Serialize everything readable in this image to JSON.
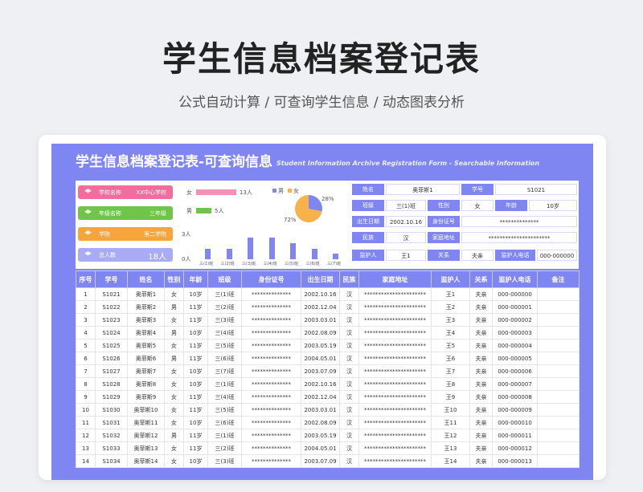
{
  "hero": {
    "title": "学生信息档案登记表",
    "subtitle": "公式自动计算 /  可查询学生信息  / 动态图表分析"
  },
  "sheet": {
    "title": "学生信息档案登记表-可查询信息",
    "title_en": "Student Information Archive Registration Form - Searchable Information"
  },
  "summary": [
    {
      "label": "学校名称",
      "value": "XX中心学校",
      "color": "#f26d9b"
    },
    {
      "label": "年级名称",
      "value": "三年级",
      "color": "#6ec54a"
    },
    {
      "label": "学院",
      "value": "第二学院",
      "color": "#f7a43a"
    },
    {
      "label": "总人数",
      "value": "18人",
      "color": "#a9acf5"
    }
  ],
  "gender_bars": [
    {
      "label": "女",
      "value": 13,
      "display": "13人",
      "color": "#f590b6"
    },
    {
      "label": "男",
      "value": 5,
      "display": "5人",
      "color": "#6ec54a"
    }
  ],
  "pie": {
    "legend": [
      "男",
      "女"
    ],
    "male_pct": 28,
    "female_pct": 72,
    "male_label": "28%",
    "female_label": "72%",
    "male_color": "#7f86f2",
    "female_color": "#f7b24a"
  },
  "class_chart": {
    "ytop": "3人",
    "ybottom": "0人",
    "categories": [
      "三(1)班",
      "三(2)班",
      "三(3)班",
      "三(4)班",
      "三(5)班",
      "三(6)班",
      "三(7)班"
    ],
    "values": [
      2,
      2,
      4,
      4,
      3,
      2,
      1
    ],
    "ymax": 4.5
  },
  "info": {
    "name_label": "姓名",
    "name": "奥菲斯1",
    "id_label": "学号",
    "id": "S1021",
    "class_label": "班级",
    "class": "三(1)班",
    "gender_label": "性别",
    "gender": "女",
    "age_label": "年龄",
    "age": "10岁",
    "birth_label": "出生日期",
    "birth": "2002.10.16",
    "idcard_label": "身份证号",
    "idcard": "**************",
    "ethnic_label": "民族",
    "ethnic": "汉",
    "address_label": "家庭地址",
    "address": "**********************",
    "guardian_label": "监护人",
    "guardian": "王1",
    "relation_label": "关系",
    "relation": "夫亲",
    "phone_label": "监护人电话",
    "phone": "000-000000"
  },
  "table": {
    "headers": [
      "序号",
      "学号",
      "姓名",
      "性别",
      "年龄",
      "班级",
      "身份证号",
      "出生日期",
      "民族",
      "家庭地址",
      "监护人",
      "关系",
      "监护人电话",
      "备注"
    ],
    "rows": [
      [
        "1",
        "S1021",
        "奥菲斯1",
        "女",
        "10岁",
        "三(1)班",
        "**************",
        "2002.10.16",
        "汉",
        "**********************",
        "王1",
        "夫亲",
        "000-000000",
        ""
      ],
      [
        "2",
        "S1022",
        "奥菲斯2",
        "男",
        "11岁",
        "三(2)班",
        "**************",
        "2002.12.04",
        "汉",
        "**********************",
        "王2",
        "夫亲",
        "000-000001",
        ""
      ],
      [
        "3",
        "S1023",
        "奥菲斯3",
        "女",
        "11岁",
        "三(3)班",
        "**************",
        "2003.03.01",
        "汉",
        "**********************",
        "王3",
        "夫亲",
        "000-000002",
        ""
      ],
      [
        "4",
        "S1024",
        "奥菲斯4",
        "男",
        "10岁",
        "三(4)班",
        "**************",
        "2002.08.09",
        "汉",
        "**********************",
        "王4",
        "夫亲",
        "000-000003",
        ""
      ],
      [
        "5",
        "S1025",
        "奥菲斯5",
        "女",
        "11岁",
        "三(5)班",
        "**************",
        "2003.05.19",
        "汉",
        "**********************",
        "王5",
        "夫亲",
        "000-000004",
        ""
      ],
      [
        "6",
        "S1026",
        "奥菲斯6",
        "男",
        "11岁",
        "三(6)班",
        "**************",
        "2004.05.01",
        "汉",
        "**********************",
        "王6",
        "夫亲",
        "000-000005",
        ""
      ],
      [
        "7",
        "S1027",
        "奥菲斯7",
        "女",
        "10岁",
        "三(7)班",
        "**************",
        "2003.07.09",
        "汉",
        "**********************",
        "王7",
        "夫亲",
        "000-000006",
        ""
      ],
      [
        "8",
        "S1028",
        "奥菲斯8",
        "女",
        "10岁",
        "三(1)班",
        "**************",
        "2002.10.16",
        "汉",
        "**********************",
        "王8",
        "夫亲",
        "000-000007",
        ""
      ],
      [
        "9",
        "S1029",
        "奥菲斯9",
        "女",
        "11岁",
        "三(4)班",
        "**************",
        "2002.12.04",
        "汉",
        "**********************",
        "王9",
        "夫亲",
        "000-000008",
        ""
      ],
      [
        "10",
        "S1030",
        "奥菲斯10",
        "女",
        "11岁",
        "三(5)班",
        "**************",
        "2003.03.01",
        "汉",
        "**********************",
        "王10",
        "夫亲",
        "000-000009",
        ""
      ],
      [
        "11",
        "S1031",
        "奥菲斯11",
        "女",
        "10岁",
        "三(6)班",
        "**************",
        "2002.08.09",
        "汉",
        "**********************",
        "王11",
        "夫亲",
        "000-000010",
        ""
      ],
      [
        "12",
        "S1032",
        "奥菲斯12",
        "男",
        "11岁",
        "三(1)班",
        "**************",
        "2003.05.19",
        "汉",
        "**********************",
        "王12",
        "夫亲",
        "000-000011",
        ""
      ],
      [
        "13",
        "S1033",
        "奥菲斯13",
        "女",
        "11岁",
        "三(2)班",
        "**************",
        "2004.05.01",
        "汉",
        "**********************",
        "王13",
        "夫亲",
        "000-000012",
        ""
      ],
      [
        "14",
        "S1034",
        "奥菲斯14",
        "女",
        "10岁",
        "三(3)班",
        "**************",
        "2003.07.09",
        "汉",
        "**********************",
        "王14",
        "夫亲",
        "000-000013",
        ""
      ]
    ]
  }
}
